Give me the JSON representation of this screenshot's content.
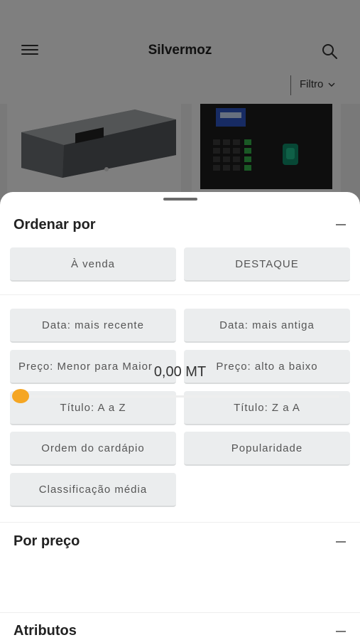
{
  "app": {
    "title": "Silvermoz",
    "filter_label": "Filtro"
  },
  "sheet": {
    "sort": {
      "title": "Ordenar por",
      "primary_options": [
        "À venda",
        "DESTAQUE"
      ],
      "options": [
        "Data: mais recente",
        "Data: mais antiga",
        "Preço: Menor para Maior",
        "Preço: alto a baixo",
        "Título: A a Z",
        "Título: Z a A",
        "Ordem do cardápio",
        "Popularidade",
        "Classificação média"
      ]
    },
    "price": {
      "title": "Por preço",
      "value": "0,00 MT",
      "slider_fraction": 0
    },
    "attributes": {
      "title": "Atributos"
    }
  },
  "colors": {
    "accent": "#f5a623",
    "chip_bg": "#ebedee"
  },
  "icons": [
    "menu-icon",
    "search-icon",
    "chevron-down-icon",
    "collapse-icon"
  ]
}
